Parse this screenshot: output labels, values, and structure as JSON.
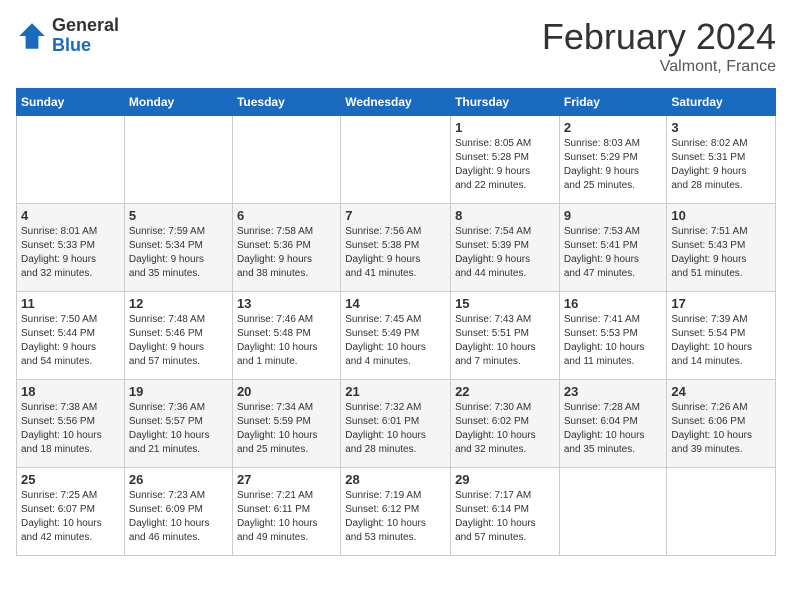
{
  "logo": {
    "general": "General",
    "blue": "Blue"
  },
  "title": {
    "month_year": "February 2024",
    "location": "Valmont, France"
  },
  "headers": [
    "Sunday",
    "Monday",
    "Tuesday",
    "Wednesday",
    "Thursday",
    "Friday",
    "Saturday"
  ],
  "weeks": [
    [
      {
        "day": "",
        "info": ""
      },
      {
        "day": "",
        "info": ""
      },
      {
        "day": "",
        "info": ""
      },
      {
        "day": "",
        "info": ""
      },
      {
        "day": "1",
        "info": "Sunrise: 8:05 AM\nSunset: 5:28 PM\nDaylight: 9 hours\nand 22 minutes."
      },
      {
        "day": "2",
        "info": "Sunrise: 8:03 AM\nSunset: 5:29 PM\nDaylight: 9 hours\nand 25 minutes."
      },
      {
        "day": "3",
        "info": "Sunrise: 8:02 AM\nSunset: 5:31 PM\nDaylight: 9 hours\nand 28 minutes."
      }
    ],
    [
      {
        "day": "4",
        "info": "Sunrise: 8:01 AM\nSunset: 5:33 PM\nDaylight: 9 hours\nand 32 minutes."
      },
      {
        "day": "5",
        "info": "Sunrise: 7:59 AM\nSunset: 5:34 PM\nDaylight: 9 hours\nand 35 minutes."
      },
      {
        "day": "6",
        "info": "Sunrise: 7:58 AM\nSunset: 5:36 PM\nDaylight: 9 hours\nand 38 minutes."
      },
      {
        "day": "7",
        "info": "Sunrise: 7:56 AM\nSunset: 5:38 PM\nDaylight: 9 hours\nand 41 minutes."
      },
      {
        "day": "8",
        "info": "Sunrise: 7:54 AM\nSunset: 5:39 PM\nDaylight: 9 hours\nand 44 minutes."
      },
      {
        "day": "9",
        "info": "Sunrise: 7:53 AM\nSunset: 5:41 PM\nDaylight: 9 hours\nand 47 minutes."
      },
      {
        "day": "10",
        "info": "Sunrise: 7:51 AM\nSunset: 5:43 PM\nDaylight: 9 hours\nand 51 minutes."
      }
    ],
    [
      {
        "day": "11",
        "info": "Sunrise: 7:50 AM\nSunset: 5:44 PM\nDaylight: 9 hours\nand 54 minutes."
      },
      {
        "day": "12",
        "info": "Sunrise: 7:48 AM\nSunset: 5:46 PM\nDaylight: 9 hours\nand 57 minutes."
      },
      {
        "day": "13",
        "info": "Sunrise: 7:46 AM\nSunset: 5:48 PM\nDaylight: 10 hours\nand 1 minute."
      },
      {
        "day": "14",
        "info": "Sunrise: 7:45 AM\nSunset: 5:49 PM\nDaylight: 10 hours\nand 4 minutes."
      },
      {
        "day": "15",
        "info": "Sunrise: 7:43 AM\nSunset: 5:51 PM\nDaylight: 10 hours\nand 7 minutes."
      },
      {
        "day": "16",
        "info": "Sunrise: 7:41 AM\nSunset: 5:53 PM\nDaylight: 10 hours\nand 11 minutes."
      },
      {
        "day": "17",
        "info": "Sunrise: 7:39 AM\nSunset: 5:54 PM\nDaylight: 10 hours\nand 14 minutes."
      }
    ],
    [
      {
        "day": "18",
        "info": "Sunrise: 7:38 AM\nSunset: 5:56 PM\nDaylight: 10 hours\nand 18 minutes."
      },
      {
        "day": "19",
        "info": "Sunrise: 7:36 AM\nSunset: 5:57 PM\nDaylight: 10 hours\nand 21 minutes."
      },
      {
        "day": "20",
        "info": "Sunrise: 7:34 AM\nSunset: 5:59 PM\nDaylight: 10 hours\nand 25 minutes."
      },
      {
        "day": "21",
        "info": "Sunrise: 7:32 AM\nSunset: 6:01 PM\nDaylight: 10 hours\nand 28 minutes."
      },
      {
        "day": "22",
        "info": "Sunrise: 7:30 AM\nSunset: 6:02 PM\nDaylight: 10 hours\nand 32 minutes."
      },
      {
        "day": "23",
        "info": "Sunrise: 7:28 AM\nSunset: 6:04 PM\nDaylight: 10 hours\nand 35 minutes."
      },
      {
        "day": "24",
        "info": "Sunrise: 7:26 AM\nSunset: 6:06 PM\nDaylight: 10 hours\nand 39 minutes."
      }
    ],
    [
      {
        "day": "25",
        "info": "Sunrise: 7:25 AM\nSunset: 6:07 PM\nDaylight: 10 hours\nand 42 minutes."
      },
      {
        "day": "26",
        "info": "Sunrise: 7:23 AM\nSunset: 6:09 PM\nDaylight: 10 hours\nand 46 minutes."
      },
      {
        "day": "27",
        "info": "Sunrise: 7:21 AM\nSunset: 6:11 PM\nDaylight: 10 hours\nand 49 minutes."
      },
      {
        "day": "28",
        "info": "Sunrise: 7:19 AM\nSunset: 6:12 PM\nDaylight: 10 hours\nand 53 minutes."
      },
      {
        "day": "29",
        "info": "Sunrise: 7:17 AM\nSunset: 6:14 PM\nDaylight: 10 hours\nand 57 minutes."
      },
      {
        "day": "",
        "info": ""
      },
      {
        "day": "",
        "info": ""
      }
    ]
  ]
}
